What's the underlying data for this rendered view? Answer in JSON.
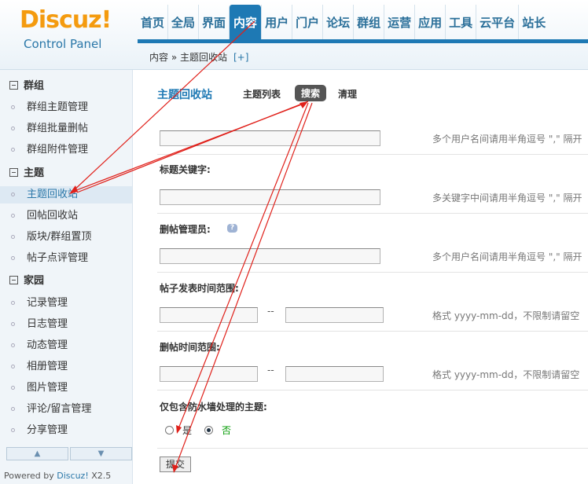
{
  "logo": {
    "title": "Discuz!",
    "subtitle": "Control Panel"
  },
  "topnav": {
    "tabs": [
      {
        "label": "首页"
      },
      {
        "label": "全局"
      },
      {
        "label": "界面"
      },
      {
        "label": "内容",
        "active": true
      },
      {
        "label": "用户"
      },
      {
        "label": "门户"
      },
      {
        "label": "论坛"
      },
      {
        "label": "群组"
      },
      {
        "label": "运营"
      },
      {
        "label": "应用"
      },
      {
        "label": "工具"
      },
      {
        "label": "云平台"
      },
      {
        "label": "站长"
      }
    ]
  },
  "breadcrumb": {
    "path": "内容 » 主题回收站",
    "add": "[+]"
  },
  "sidebar": {
    "groups": [
      {
        "title": "群组",
        "items": [
          "群组主题管理",
          "群组批量删帖",
          "群组附件管理"
        ]
      },
      {
        "title": "主题",
        "items": [
          "主题回收站",
          "回帖回收站",
          "版块/群组置顶",
          "帖子点评管理"
        ]
      },
      {
        "title": "家园",
        "items": [
          "记录管理",
          "日志管理",
          "动态管理",
          "相册管理",
          "图片管理",
          "评论/留言管理",
          "分享管理"
        ]
      }
    ],
    "active_item": "主题回收站",
    "powered_prefix": "Powered by ",
    "powered_brand": "Discuz!",
    "powered_version": " X2.5"
  },
  "main": {
    "title": "主题回收站",
    "subtabs": [
      {
        "label": "主题列表"
      },
      {
        "label": "搜索",
        "active": true
      },
      {
        "label": "清理"
      }
    ],
    "fields": {
      "author_hint": "多个用户名间请用半角逗号 \",\" 隔开",
      "keyword_label": "标题关键字:",
      "keyword_hint": "多关键字中间请用半角逗号 \",\" 隔开",
      "admin_label": "删帖管理员:",
      "admin_hint": "多个用户名间请用半角逗号 \",\" 隔开",
      "post_time_label": "帖子发表时间范围:",
      "post_time_hint": "格式 yyyy-mm-dd，不限制请留空",
      "del_time_label": "删帖时间范围:",
      "del_time_hint": "格式 yyyy-mm-dd，不限制请留空",
      "range_sep": "--",
      "waterwall_label": "仅包含防水墙处理的主题:",
      "yes": "是",
      "no": "否"
    },
    "waterwall_selected": "否",
    "submit": "提交"
  },
  "colors": {
    "accent": "#1e79b4",
    "logo": "#f49b0f",
    "annotation": "#e0201a"
  }
}
